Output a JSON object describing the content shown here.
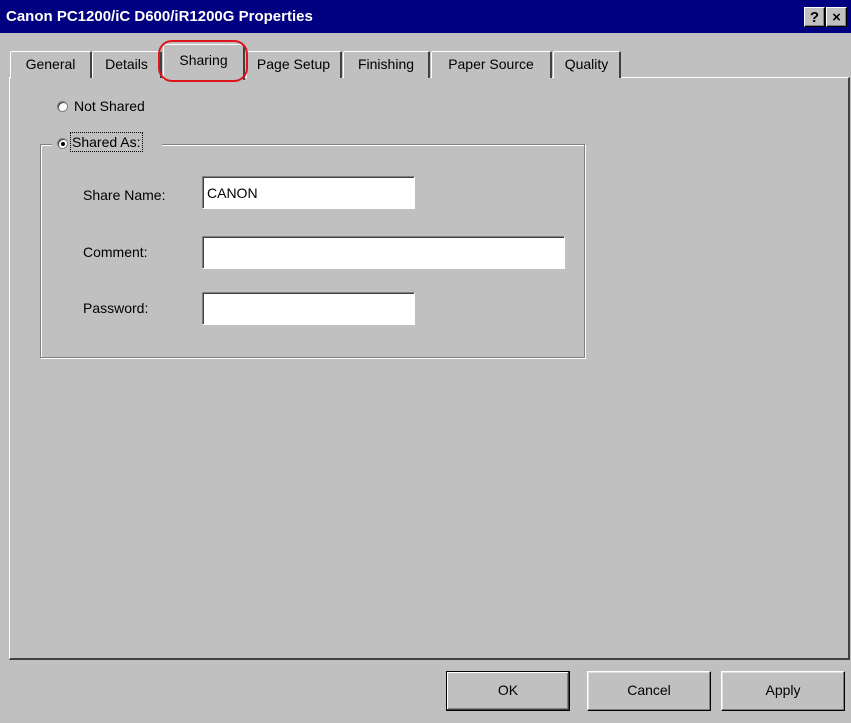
{
  "window": {
    "title": "Canon PC1200/iC D600/iR1200G Properties"
  },
  "titlebar": {
    "help_glyph": "?",
    "close_glyph": "×"
  },
  "tabs": [
    {
      "label": "General"
    },
    {
      "label": "Details"
    },
    {
      "label": "Sharing",
      "active": true
    },
    {
      "label": "Page Setup"
    },
    {
      "label": "Finishing"
    },
    {
      "label": "Paper Source"
    },
    {
      "label": "Quality"
    }
  ],
  "sharing": {
    "not_shared_label": "Not Shared",
    "not_shared_checked": false,
    "shared_as_label": "Shared As:",
    "shared_as_checked": true,
    "share_name_label": "Share Name:",
    "share_name_value": "CANON",
    "comment_label": "Comment:",
    "comment_value": "",
    "password_label": "Password:",
    "password_value": ""
  },
  "buttons": {
    "ok": "OK",
    "cancel": "Cancel",
    "apply": "Apply"
  },
  "colors": {
    "titlebar": "#000080",
    "highlight_ring": "#e0141c",
    "face": "#c0c0c0"
  }
}
